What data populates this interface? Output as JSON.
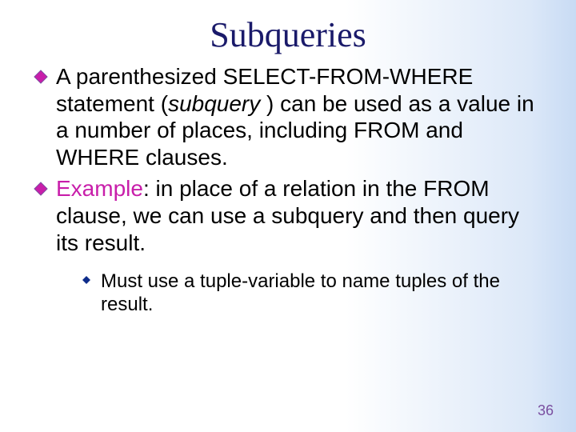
{
  "title": "Subqueries",
  "bullets": [
    {
      "runs": [
        {
          "text": "A parenthesized SELECT-FROM-WHERE statement ("
        },
        {
          "text": "subquery",
          "italic": true
        },
        {
          "text": " ) can be used as a value in a number of places, including FROM and WHERE clauses."
        }
      ]
    },
    {
      "runs": [
        {
          "text": "Example",
          "magenta": true
        },
        {
          "text": ": in place of a relation in the FROM clause, we can use a subquery and then query its result."
        }
      ]
    }
  ],
  "subbullets": [
    "Must use a tuple-variable to name tuples of the result."
  ],
  "page_number": "36"
}
